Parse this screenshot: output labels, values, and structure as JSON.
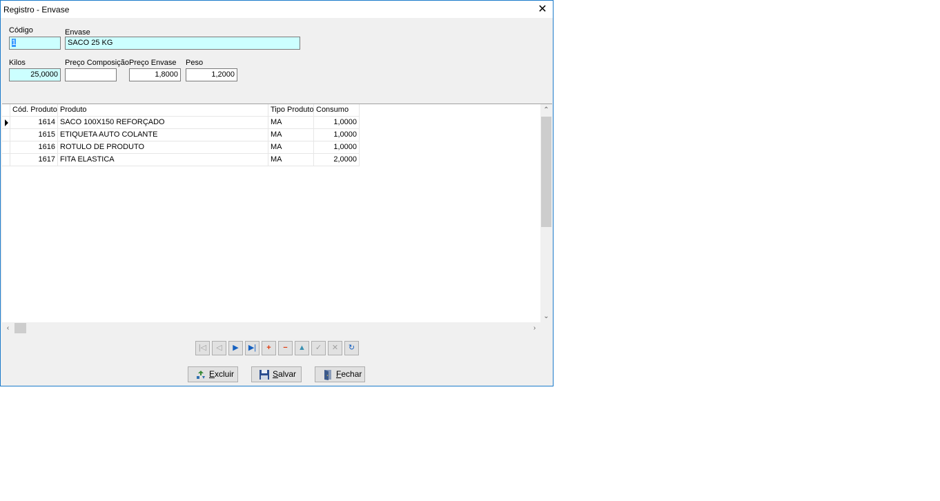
{
  "window": {
    "title": "Registro - Envase",
    "close_glyph": "✕"
  },
  "form": {
    "codigo": {
      "label": "Código",
      "value": "1"
    },
    "envase": {
      "label": "Envase",
      "value": "SACO 25 KG"
    },
    "kilos": {
      "label": "Kilos",
      "value": "25,0000"
    },
    "preco_composicao": {
      "label": "Preço Composição",
      "value": ""
    },
    "preco_envase": {
      "label": "Preço Envase",
      "value": "1,8000"
    },
    "peso": {
      "label": "Peso",
      "value": "1,2000"
    }
  },
  "grid": {
    "columns": [
      "Cód. Produto",
      "Produto",
      "Tipo Produto",
      "Consumo"
    ],
    "rows": [
      {
        "cod": "1614",
        "produto": "SACO 100X150 REFORÇADO",
        "tipo": "MA",
        "consumo": "1,0000"
      },
      {
        "cod": "1615",
        "produto": "ETIQUETA AUTO COLANTE",
        "tipo": "MA",
        "consumo": "1,0000"
      },
      {
        "cod": "1616",
        "produto": "ROTULO DE PRODUTO",
        "tipo": "MA",
        "consumo": "1,0000"
      },
      {
        "cod": "1617",
        "produto": "FITA ELASTICA",
        "tipo": "MA",
        "consumo": "2,0000"
      }
    ],
    "selected_row": 0
  },
  "navigator": [
    {
      "name": "nav-first-button",
      "glyph": "|◁",
      "state": "disabled"
    },
    {
      "name": "nav-prior-button",
      "glyph": "◁",
      "state": "disabled"
    },
    {
      "name": "nav-next-button",
      "glyph": "▶",
      "state": "enabled"
    },
    {
      "name": "nav-last-button",
      "glyph": "▶|",
      "state": "enabled"
    },
    {
      "name": "nav-insert-button",
      "glyph": "+",
      "state": "enabled"
    },
    {
      "name": "nav-delete-button",
      "glyph": "−",
      "state": "enabled"
    },
    {
      "name": "nav-edit-button",
      "glyph": "▲",
      "state": "enabled"
    },
    {
      "name": "nav-post-button",
      "glyph": "✓",
      "state": "disabled"
    },
    {
      "name": "nav-cancel-button",
      "glyph": "✕",
      "state": "disabled"
    },
    {
      "name": "nav-refresh-button",
      "glyph": "↻",
      "state": "enabled"
    }
  ],
  "buttons": {
    "excluir": {
      "accel": "E",
      "rest": "xcluir"
    },
    "salvar": {
      "accel": "S",
      "rest": "alvar"
    },
    "fechar": {
      "accel": "F",
      "rest": "echar"
    }
  }
}
